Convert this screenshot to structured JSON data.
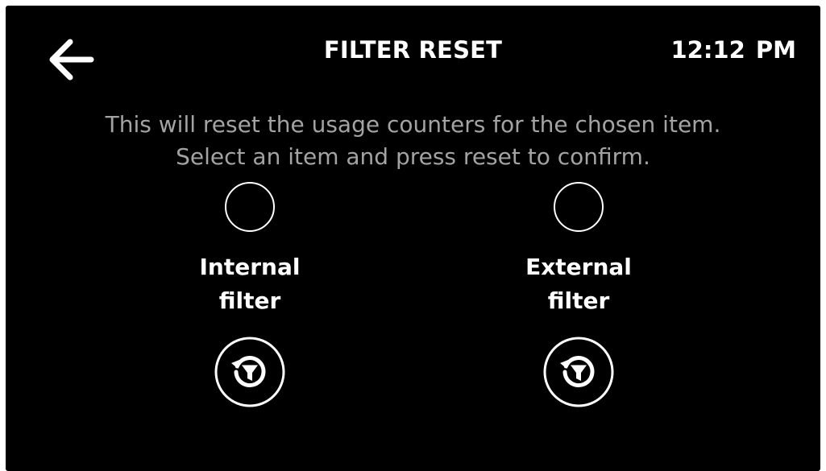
{
  "header": {
    "back_icon": "arrow-left-icon",
    "title": "FILTER RESET",
    "time": "12:12 PM"
  },
  "instructions": {
    "line1": "This will reset the usage counters for the chosen item.",
    "line2": "Select an item and press reset to confirm."
  },
  "options": [
    {
      "label_line1": "Internal",
      "label_line2": "filter",
      "selected": false,
      "reset_icon": "filter-reset-icon"
    },
    {
      "label_line1": "External",
      "label_line2": "filter",
      "selected": false,
      "reset_icon": "filter-reset-icon"
    }
  ],
  "colors": {
    "background": "#000000",
    "primary_text": "#ffffff",
    "secondary_text": "#a3a3a3"
  }
}
